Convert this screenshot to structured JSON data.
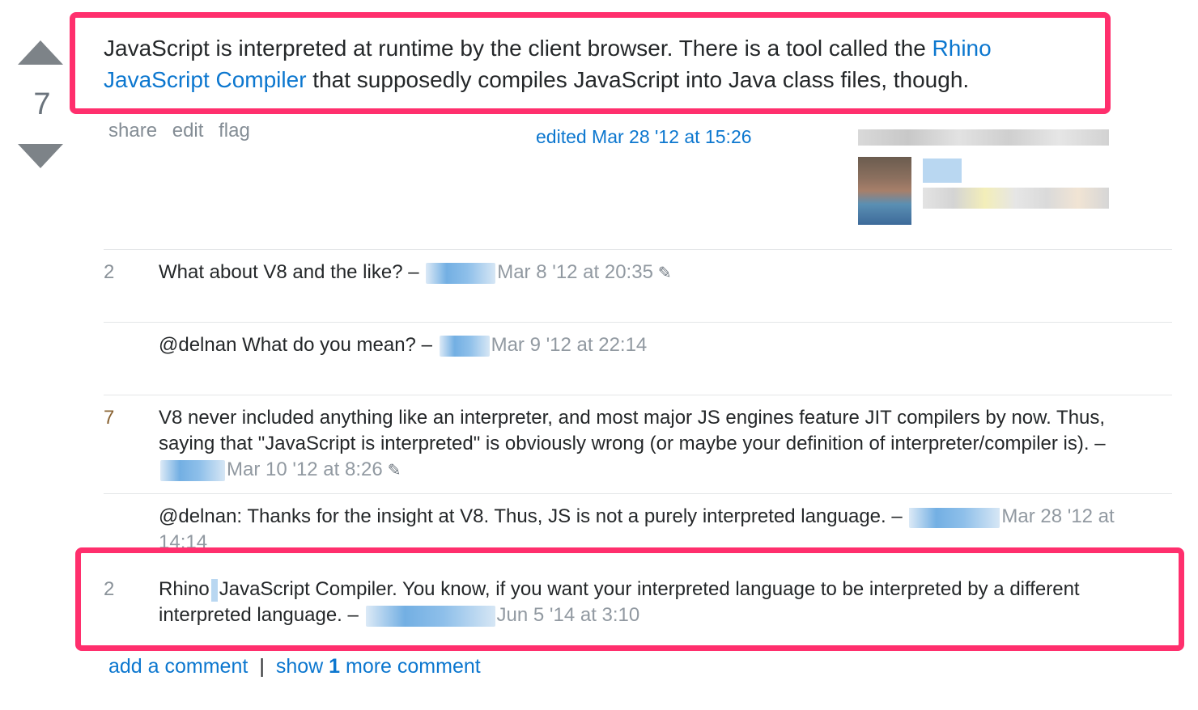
{
  "answer": {
    "vote_count": "7",
    "text_before_link": "JavaScript is interpreted at runtime by the client browser. There is a tool called the ",
    "link_text": "Rhino JavaScript Compiler",
    "text_after_link": " that supposedly compiles JavaScript into Java class files, though.",
    "menu": {
      "share": "share",
      "edit": "edit",
      "flag": "flag"
    },
    "edited": "edited Mar 28 '12 at 15:26"
  },
  "comments": [
    {
      "score": "2",
      "text": "What about V8 and the like? – ",
      "date": "Mar 8 '12 at 20:35",
      "edited_icon": "pencil-icon"
    },
    {
      "score": "",
      "text": "@delnan What do you mean? – ",
      "date": "Mar 9 '12 at 22:14"
    },
    {
      "score": "7",
      "text": "V8 never included anything like an interpreter, and most major JS engines feature JIT compilers by now. Thus, saying that \"JavaScript is interpreted\" is obviously wrong (or maybe your definition of interpreter/compiler is). – ",
      "date": "Mar 10 '12 at 8:26",
      "edited_icon": "pencil-icon"
    },
    {
      "score": "",
      "text": "@delnan: Thanks for the insight at V8. Thus, JS is not a purely interpreted language. – ",
      "date": "Mar 28 '12 at 14:14"
    },
    {
      "score": "2",
      "text_a": "Rhino",
      "text_b": "JavaScript Compiler. You know, if you want your interpreted language to be interpreted by a different interpreted language. – ",
      "date": "Jun 5 '14 at 3:10"
    }
  ],
  "footer": {
    "add_comment": "add a comment",
    "separator": "|",
    "show_prefix": "show ",
    "show_count": "1",
    "show_suffix": " more comment"
  },
  "colors": {
    "link": "#0c77cf",
    "highlight": "#ff2f6d",
    "muted": "#9199a1"
  }
}
